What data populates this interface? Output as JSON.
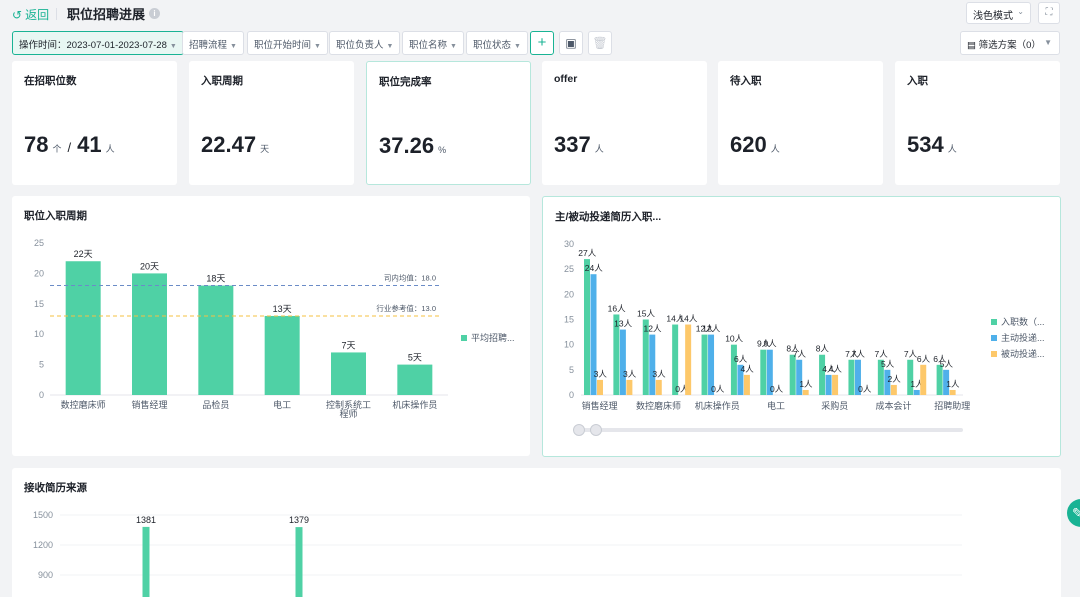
{
  "header": {
    "back_label": "返回",
    "title": "职位招聘进展",
    "theme_mode": "浅色模式"
  },
  "filters": [
    {
      "label": "操作时间：2023-07-01-2023-07-28"
    },
    {
      "label": "招聘流程"
    },
    {
      "label": "职位开始时间"
    },
    {
      "label": "职位负责人"
    },
    {
      "label": "职位名称"
    },
    {
      "label": "职位状态"
    }
  ],
  "scheme_label": "筛选方案（0）",
  "kpis": [
    {
      "title": "在招职位数",
      "value": "78",
      "unit": "个",
      "value2": "41",
      "unit2": "人"
    },
    {
      "title": "入职周期",
      "value": "22.47",
      "unit": "天"
    },
    {
      "title": "职位完成率",
      "value": "37.26",
      "unit": "%"
    },
    {
      "title": "offer",
      "value": "337",
      "unit": "人"
    },
    {
      "title": "待入职",
      "value": "620",
      "unit": "人"
    },
    {
      "title": "入职",
      "value": "534",
      "unit": "人"
    }
  ],
  "colors": {
    "green": "#4fd1a5",
    "blue": "#4fb0ea",
    "orange": "#fdc86a",
    "accent": "#19b394"
  },
  "chart_data": [
    {
      "title": "职位入职周期",
      "type": "bar",
      "categories": [
        "数控磨床师",
        "销售经理",
        "品检员",
        "电工",
        "控制系统工程师",
        "机床操作员"
      ],
      "tick_labels": [
        [
          "数控磨床师"
        ],
        [
          "销售经理"
        ],
        [
          "品检员"
        ],
        [
          "电工"
        ],
        [
          "控制系统工",
          "程师"
        ],
        [
          "机床操作员"
        ]
      ],
      "series": [
        {
          "name": "平均招聘...",
          "values": [
            22,
            20,
            18,
            13,
            7,
            5
          ]
        }
      ],
      "data_labels": [
        "22天",
        "20天",
        "18天",
        "13天",
        "7天",
        "5天"
      ],
      "ylim": [
        0,
        25
      ],
      "yticks": [
        0,
        5,
        10,
        15,
        20,
        25
      ],
      "reference_lines": [
        {
          "label": "司内均值：18.0",
          "value": 18
        },
        {
          "label": "行业参考值：13.0",
          "value": 13
        }
      ],
      "legend_position": "right"
    },
    {
      "title": "主/被动投递简历入职...",
      "type": "bar",
      "categories": [
        "销售经理",
        "",
        "数控磨床师",
        "",
        "机床操作员",
        "",
        "电工",
        "",
        "采购员",
        "",
        "成本会计",
        "",
        "招聘助理"
      ],
      "x_labels": [
        "销售经理",
        "数控磨床师",
        "机床操作员",
        "电工",
        "采购员",
        "成本会计",
        "招聘助理"
      ],
      "series": [
        {
          "name": "入职数（...",
          "values": [
            27,
            16,
            15,
            14,
            12,
            10,
            9,
            8,
            8,
            7,
            7,
            7,
            6
          ]
        },
        {
          "name": "主动投递...",
          "values": [
            24,
            13,
            12,
            0,
            12,
            6,
            9,
            7,
            4,
            7,
            5,
            1,
            5
          ]
        },
        {
          "name": "被动投递...",
          "values": [
            3,
            3,
            3,
            14,
            0,
            4,
            0,
            1,
            4,
            0,
            2,
            6,
            1
          ]
        }
      ],
      "ylim": [
        0,
        30
      ],
      "yticks": [
        0,
        5,
        10,
        15,
        20,
        25,
        30
      ],
      "legend_position": "right"
    },
    {
      "title": "接收简历来源",
      "type": "bar",
      "values": [
        1381,
        1379
      ],
      "data_labels": [
        "1381",
        "1379"
      ],
      "yticks": [
        900,
        1200,
        1500
      ]
    }
  ]
}
